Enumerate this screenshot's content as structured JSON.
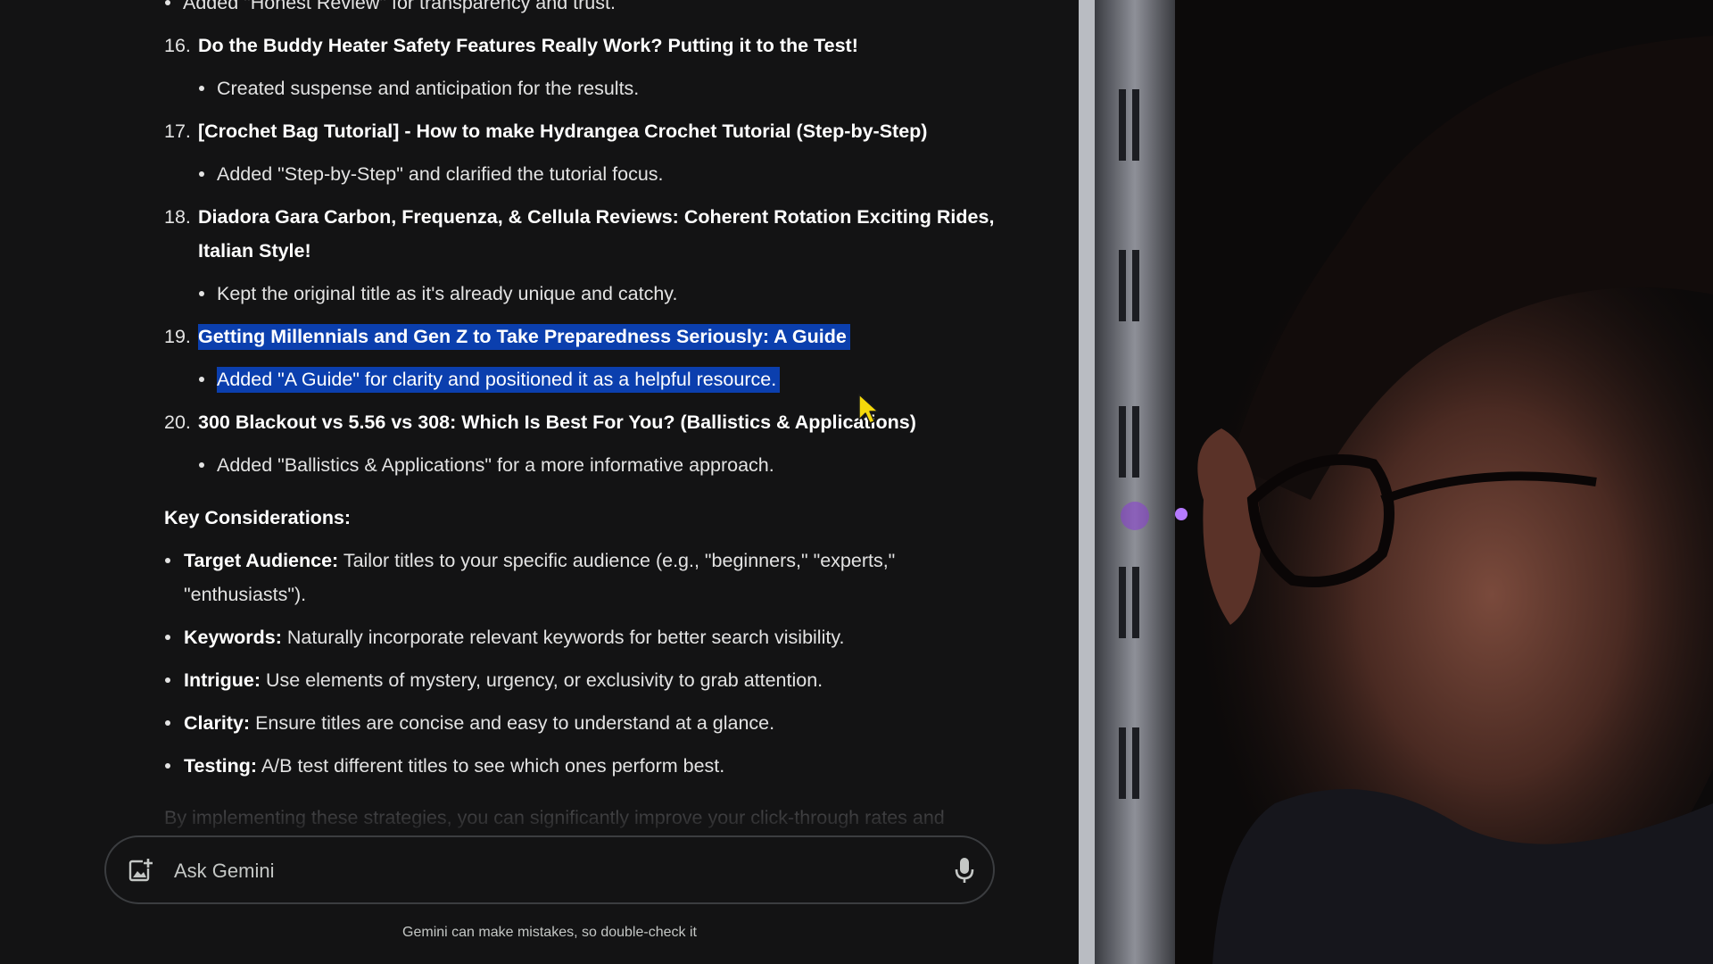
{
  "response": {
    "partial_top_line": "Added \"Honest Review\" for transparency and trust.",
    "items": [
      {
        "number": "16.",
        "title": "Do the Buddy Heater Safety Features Really Work? Putting it to the Test!",
        "note": "Created suspense and anticipation for the results."
      },
      {
        "number": "17.",
        "title": "[Crochet Bag Tutorial] - How to make Hydrangea Crochet Tutorial (Step-by-Step)",
        "note": "Added \"Step-by-Step\" and clarified the tutorial focus."
      },
      {
        "number": "18.",
        "title": "Diadora Gara Carbon, Frequenza, & Cellula Reviews: Coherent Rotation Exciting Rides, Italian Style!",
        "note": "Kept the original title as it's already unique and catchy."
      },
      {
        "number": "19.",
        "title": "Getting Millennials and Gen Z to Take Preparedness Seriously: A Guide",
        "note": "Added \"A Guide\" for clarity and positioned it as a helpful resource.",
        "selected": true
      },
      {
        "number": "20.",
        "title": "300 Blackout vs 5.56 vs 308: Which Is Best For You? (Ballistics & Applications)",
        "note": "Added \"Ballistics & Applications\" for a more informative approach."
      }
    ],
    "key_heading": "Key Considerations:",
    "considerations": [
      {
        "term": "Target Audience:",
        "text": "Tailor titles to your specific audience (e.g., \"beginners,\" \"experts,\" \"enthusiasts\")."
      },
      {
        "term": "Keywords:",
        "text": "Naturally incorporate relevant keywords for better search visibility."
      },
      {
        "term": "Intrigue:",
        "text": "Use elements of mystery, urgency, or exclusivity to grab attention."
      },
      {
        "term": "Clarity:",
        "text": "Ensure titles are concise and easy to understand at a glance."
      },
      {
        "term": "Testing:",
        "text": "A/B test different titles to see which ones perform best."
      }
    ],
    "closing": "By implementing these strategies, you can significantly improve your click-through rates and"
  },
  "input": {
    "placeholder": "Ask Gemini",
    "image_icon": "add-image-icon",
    "mic_icon": "microphone-icon"
  },
  "disclaimer": "Gemini can make mistakes, so double-check it",
  "colors": {
    "background": "#131314",
    "text": "#e3e3e3",
    "selection": "#0b3fae",
    "input_border": "#3b3d40",
    "cursor": "#f5d90a"
  }
}
